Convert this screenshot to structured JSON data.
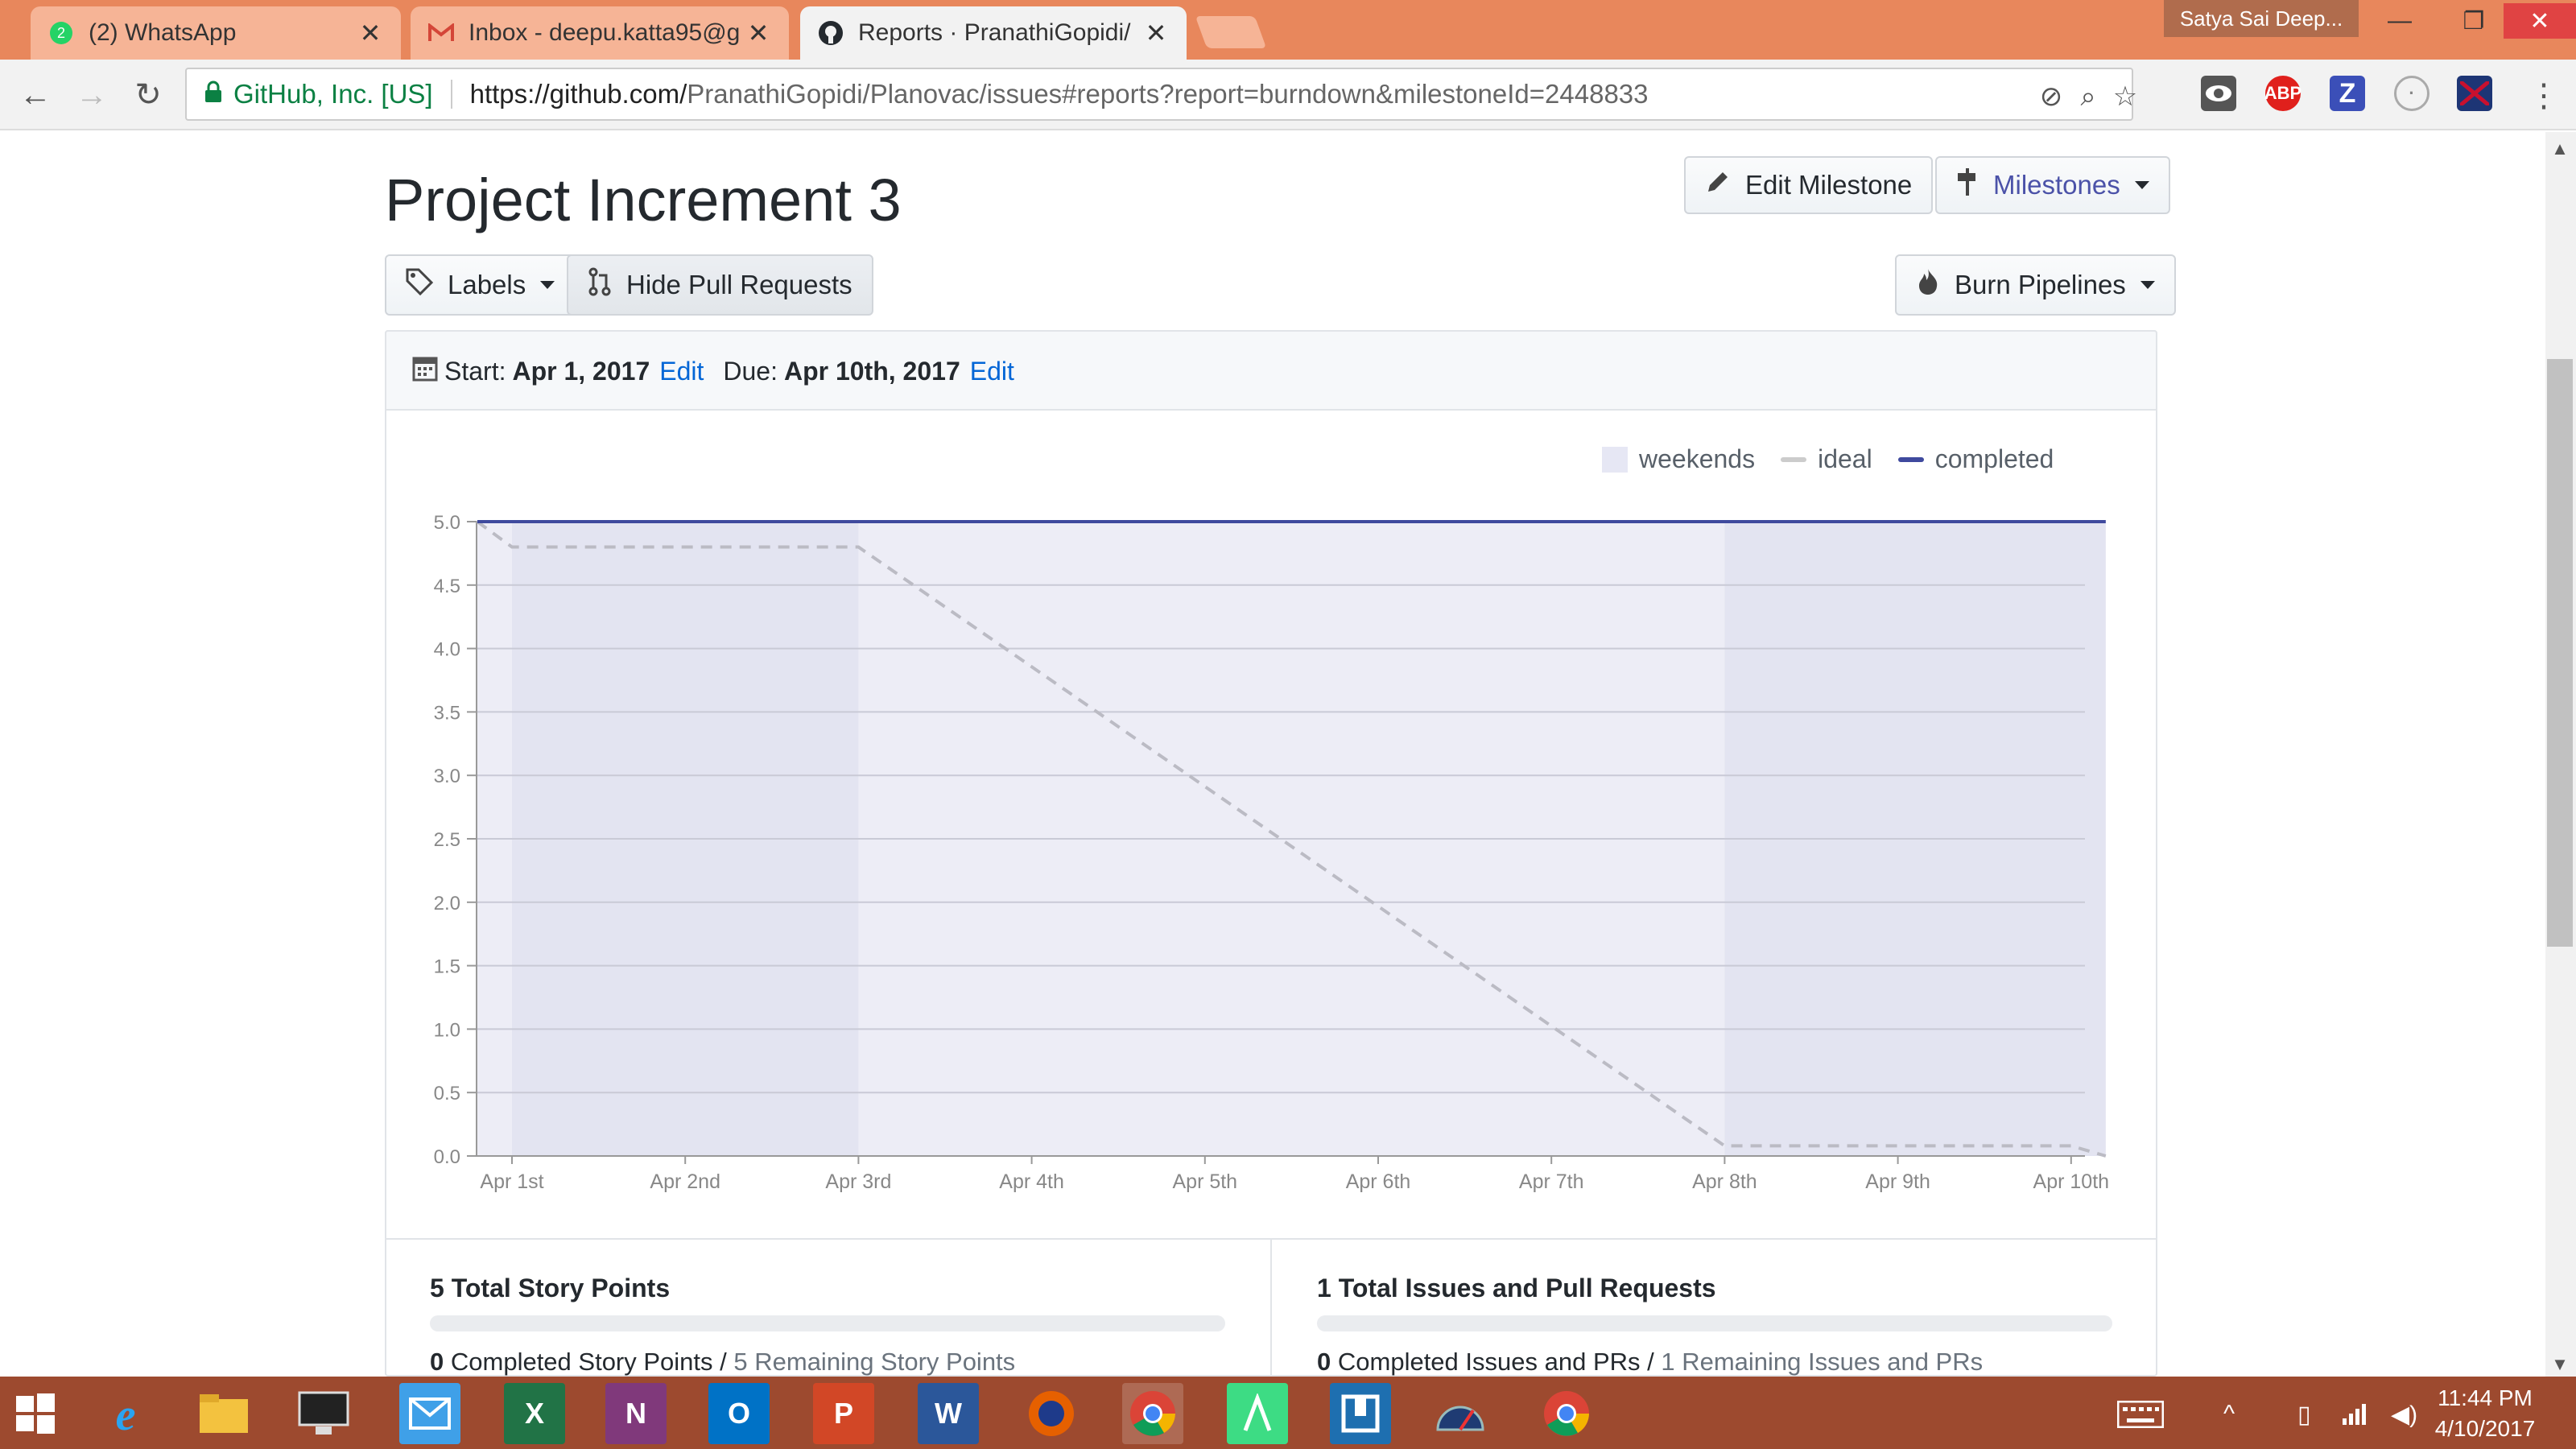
{
  "browser": {
    "tabs": [
      {
        "title": "(2) WhatsApp",
        "badge": "2",
        "icon": "whatsapp-icon",
        "active": false
      },
      {
        "title": "Inbox - deepu.katta95@g",
        "icon": "gmail-icon",
        "active": false
      },
      {
        "title": "Reports · PranathiGopidi/",
        "icon": "github-icon",
        "active": true
      }
    ],
    "profile_name": "Satya Sai Deep...",
    "site_identity": "GitHub, Inc. [US]",
    "url_host": "https://github.com/",
    "url_path": "PranathiGopidi/Planovac/issues#reports?report=burndown&milestoneId=2448833",
    "extensions": [
      "eye-extension-icon",
      "abp-extension-icon",
      "zotero-extension-icon",
      "circle-extension-icon",
      "flag-extension-icon"
    ],
    "abp_label": "ABP",
    "z_label": "Z"
  },
  "page": {
    "title": "Project Increment 3",
    "edit_milestone_label": "Edit Milestone",
    "milestones_label": "Milestones",
    "labels_label": "Labels",
    "hide_pr_label": "Hide Pull Requests",
    "burn_pipelines_label": "Burn Pipelines",
    "start_label": "Start:",
    "start_date": "Apr 1, 2017",
    "due_label": "Due:",
    "due_date": "Apr 10th, 2017",
    "edit_label": "Edit",
    "legend": {
      "weekends": "weekends",
      "ideal": "ideal",
      "completed": "completed"
    },
    "stats": {
      "story_points_title": "5 Total Story Points",
      "completed_sp_count": "0",
      "completed_sp_label": "Completed Story Points /",
      "remaining_sp": "5 Remaining Story Points",
      "issues_title": "1 Total Issues and Pull Requests",
      "completed_issues_count": "0",
      "completed_issues_label": "Completed Issues and PRs /",
      "remaining_issues": "1 Remaining Issues and PRs"
    }
  },
  "chart_data": {
    "type": "line",
    "x": [
      "Apr 1st",
      "Apr 2nd",
      "Apr 3rd",
      "Apr 4th",
      "Apr 5th",
      "Apr 6th",
      "Apr 7th",
      "Apr 8th",
      "Apr 9th",
      "Apr 10th"
    ],
    "ylim": [
      0,
      5
    ],
    "yticks": [
      "0.0",
      "0.5",
      "1.0",
      "1.5",
      "2.0",
      "2.5",
      "3.0",
      "3.5",
      "4.0",
      "4.5",
      "5.0"
    ],
    "series": [
      {
        "name": "ideal",
        "points": [
          [
            -0.2,
            5.0
          ],
          [
            0,
            4.8
          ],
          [
            2,
            4.8
          ],
          [
            7,
            0.08
          ],
          [
            9,
            0.08
          ],
          [
            9.2,
            0.0
          ]
        ],
        "color": "#bbbbc4"
      },
      {
        "name": "completed",
        "points": [
          [
            -0.2,
            5.0
          ],
          [
            9.2,
            5.0
          ]
        ],
        "color": "#3f4a9e"
      }
    ],
    "weekends": [
      [
        0,
        2
      ],
      [
        7,
        9.2
      ]
    ],
    "legend": [
      "weekends",
      "ideal",
      "completed"
    ],
    "legend_position": "top-right",
    "grid": true
  },
  "taskbar": {
    "apps": [
      "windows-start-icon",
      "internet-explorer-icon",
      "file-explorer-icon",
      "lenovo-icon",
      "mail-icon",
      "excel-icon",
      "onenote-icon",
      "outlook-icon",
      "powerpoint-icon",
      "word-icon",
      "firefox-icon",
      "chrome-icon",
      "android-studio-icon",
      "app-icon",
      "speedometer-icon",
      "chrome-icon-2"
    ],
    "time": "11:44 PM",
    "date": "4/10/2017"
  },
  "colors": {
    "tabstrip": "#e8875c",
    "taskbar": "#9d4a2f",
    "link": "#0366d6",
    "completed": "#3f4a9e"
  }
}
